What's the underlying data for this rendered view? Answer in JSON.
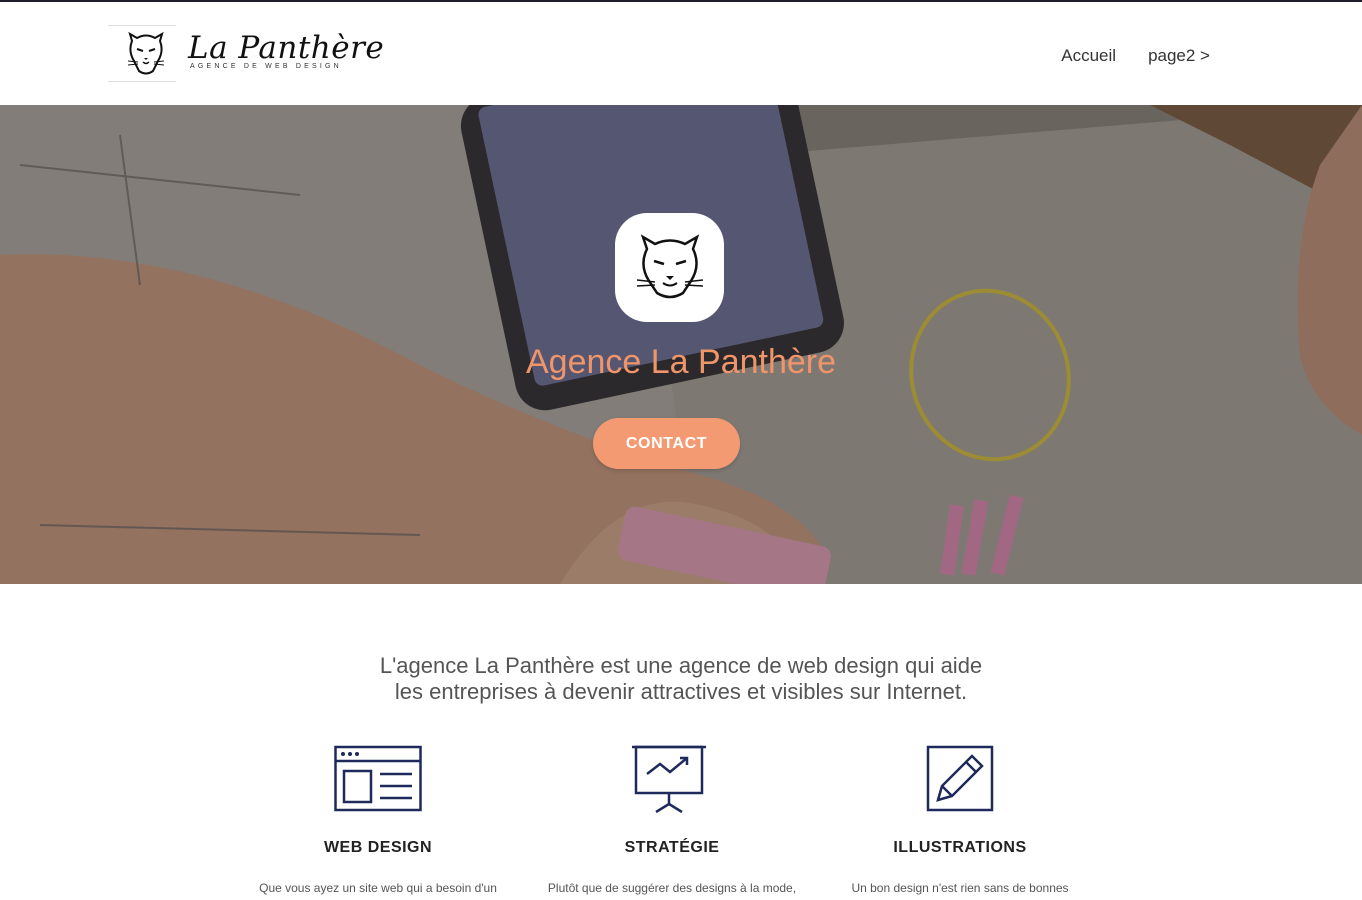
{
  "header": {
    "logo_title": "La Panthère",
    "logo_subtitle": "AGENCE DE WEB DESIGN",
    "nav": [
      {
        "label": "Accueil"
      },
      {
        "label": "page2 >"
      }
    ]
  },
  "hero": {
    "title": "Agence La Panthère",
    "cta_label": "CONTACT"
  },
  "intro": {
    "line1": "L'agence La Panthère est une agence de web design qui aide",
    "line2": "les entreprises à devenir attractives et visibles sur Internet."
  },
  "features": [
    {
      "icon": "browser-window-icon",
      "title": "WEB DESIGN",
      "text": "Que vous ayez un site web qui a besoin d'un"
    },
    {
      "icon": "presentation-chart-icon",
      "title": "STRATÉGIE",
      "text": "Plutôt que de suggérer des designs à la mode,"
    },
    {
      "icon": "pencil-edit-icon",
      "title": "ILLUSTRATIONS",
      "text": "Un bon design n'est rien sans de bonnes"
    }
  ],
  "colors": {
    "accent": "#f39a72",
    "hero_title": "#f0956a",
    "icon_stroke": "#1f2a5c"
  }
}
